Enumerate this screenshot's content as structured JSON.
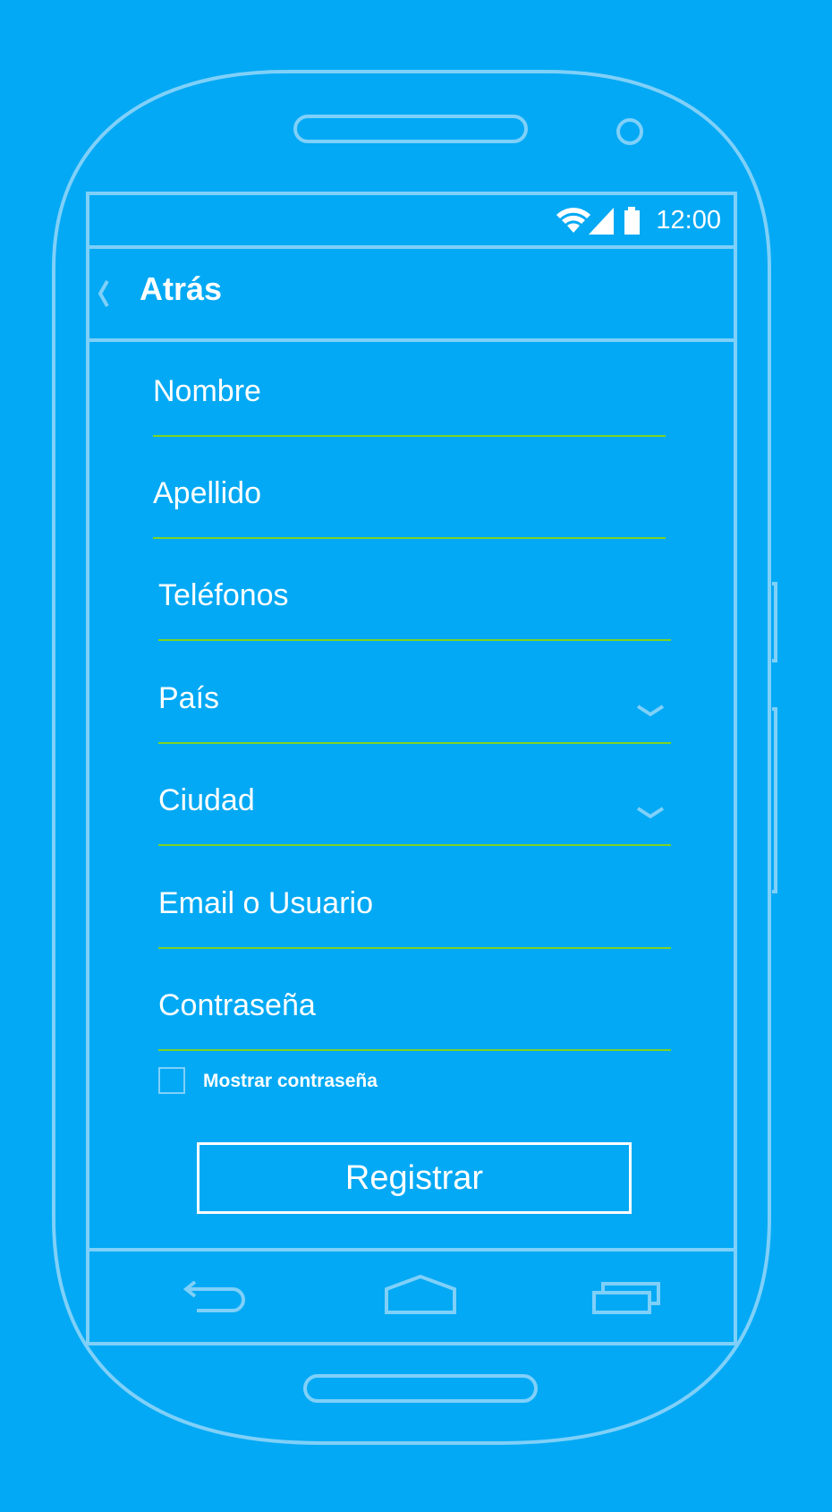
{
  "status_bar": {
    "time": "12:00",
    "icons": [
      "wifi-icon",
      "signal-icon",
      "battery-icon"
    ]
  },
  "app_bar": {
    "back_label": "Atrás",
    "back_icon": "chevron-left-icon"
  },
  "form": {
    "fields": [
      {
        "label": "Nombre"
      },
      {
        "label": "Apellido"
      },
      {
        "label": "Teléfonos"
      },
      {
        "label": "País",
        "dropdown": true
      },
      {
        "label": "Ciudad",
        "dropdown": true
      },
      {
        "label": "Email o Usuario"
      },
      {
        "label": "Contraseña"
      }
    ],
    "show_password_label": "Mostrar contraseña",
    "show_password_checked": false,
    "submit_label": "Registrar"
  },
  "nav_bar": {
    "icons": [
      "back-arrow-icon",
      "home-icon",
      "recent-apps-icon"
    ]
  },
  "colors": {
    "background": "#03a9f4",
    "outline": "#7fd0f9",
    "underline": "#7ed321",
    "text": "#ffffff"
  }
}
